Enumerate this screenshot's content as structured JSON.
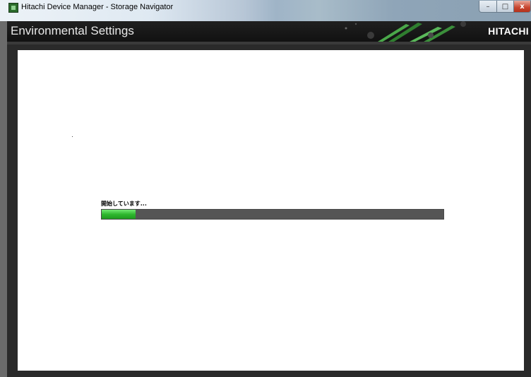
{
  "window": {
    "title": "Hitachi Device Manager - Storage Navigator",
    "controls": {
      "minimize": "–",
      "maximize": "□",
      "close": "x"
    }
  },
  "header": {
    "page_title": "Environmental Settings",
    "logo": "HITACHI"
  },
  "main": {
    "status_text": "開始しています...",
    "progress_fraction": 0.1
  },
  "colors": {
    "progress_fill": "#2fb82f",
    "progress_track": "#555555",
    "header_bg": "#1a1a1a"
  }
}
